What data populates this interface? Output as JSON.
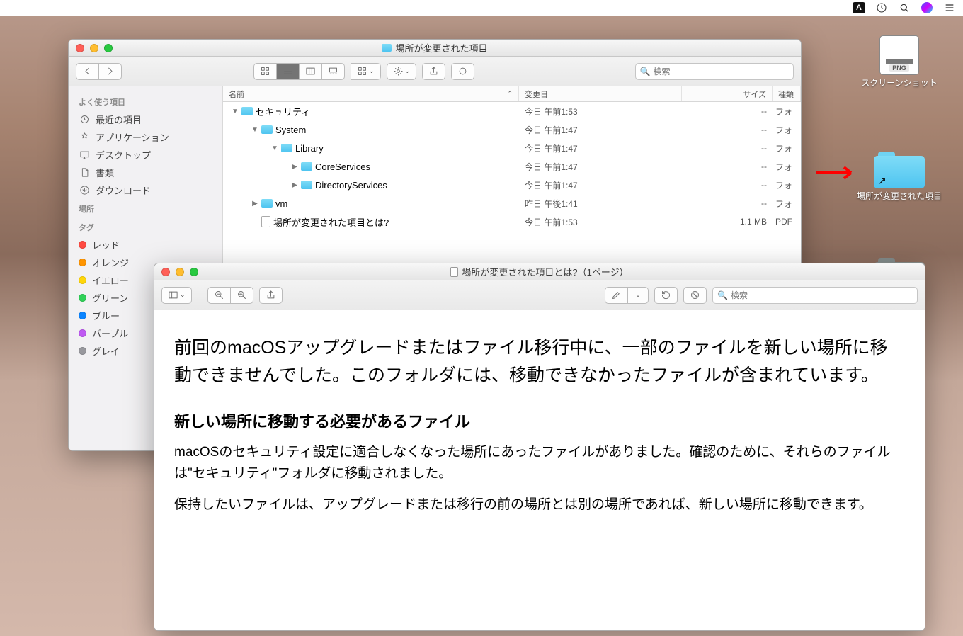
{
  "menubar": {
    "input_mode": "A"
  },
  "desktop": {
    "screenshot": {
      "label": "スクリーンショット",
      "badge": "PNG"
    },
    "relocated_folder": {
      "label": "場所が変更された項目"
    }
  },
  "finder": {
    "title": "場所が変更された項目",
    "search_placeholder": "検索",
    "sidebar": {
      "favorites_header": "よく使う項目",
      "favorites": [
        {
          "id": "recents",
          "label": "最近の項目"
        },
        {
          "id": "applications",
          "label": "アプリケーション"
        },
        {
          "id": "desktop",
          "label": "デスクトップ"
        },
        {
          "id": "documents",
          "label": "書類"
        },
        {
          "id": "downloads",
          "label": "ダウンロード"
        }
      ],
      "locations_header": "場所",
      "tags_header": "タグ",
      "tags": [
        {
          "label": "レッド",
          "color": "#ff4b42"
        },
        {
          "label": "オレンジ",
          "color": "#ff9500"
        },
        {
          "label": "イエロー",
          "color": "#ffd60a"
        },
        {
          "label": "グリーン",
          "color": "#30d158"
        },
        {
          "label": "ブルー",
          "color": "#0a84ff"
        },
        {
          "label": "パープル",
          "color": "#bf5af2"
        },
        {
          "label": "グレイ",
          "color": "#98989d"
        }
      ]
    },
    "columns": {
      "name": "名前",
      "date": "変更日",
      "size": "サイズ",
      "kind": "種類"
    },
    "rows": [
      {
        "indent": 0,
        "disclosure": "down",
        "icon": "folder",
        "name": "セキュリティ",
        "date": "今日 午前1:53",
        "size": "--",
        "kind": "フォ"
      },
      {
        "indent": 1,
        "disclosure": "down",
        "icon": "folder",
        "name": "System",
        "date": "今日 午前1:47",
        "size": "--",
        "kind": "フォ"
      },
      {
        "indent": 2,
        "disclosure": "down",
        "icon": "folder",
        "name": "Library",
        "date": "今日 午前1:47",
        "size": "--",
        "kind": "フォ"
      },
      {
        "indent": 3,
        "disclosure": "right",
        "icon": "folder",
        "name": "CoreServices",
        "date": "今日 午前1:47",
        "size": "--",
        "kind": "フォ"
      },
      {
        "indent": 3,
        "disclosure": "right",
        "icon": "folder",
        "name": "DirectoryServices",
        "date": "今日 午前1:47",
        "size": "--",
        "kind": "フォ"
      },
      {
        "indent": 1,
        "disclosure": "right",
        "icon": "folder",
        "name": "vm",
        "date": "昨日 午後1:41",
        "size": "--",
        "kind": "フォ"
      },
      {
        "indent": 1,
        "disclosure": "none",
        "icon": "doc",
        "name": "場所が変更された項目とは?",
        "date": "今日 午前1:53",
        "size": "1.1 MB",
        "kind": "PDF"
      }
    ]
  },
  "preview": {
    "title": "場所が変更された項目とは?（1ページ）",
    "search_placeholder": "検索",
    "para1": "前回のmacOSアップグレードまたはファイル移行中に、一部のファイルを新しい場所に移動できませんでした。このフォルダには、移動できなかったファイルが含まれています。",
    "heading1": "新しい場所に移動する必要があるファイル",
    "para2": "macOSのセキュリティ設定に適合しなくなった場所にあったファイルがありました。確認のために、それらのファイルは\"セキュリティ\"フォルダに移動されました。",
    "para3": "保持したいファイルは、アップグレードまたは移行の前の場所とは別の場所であれば、新しい場所に移動できます。"
  }
}
